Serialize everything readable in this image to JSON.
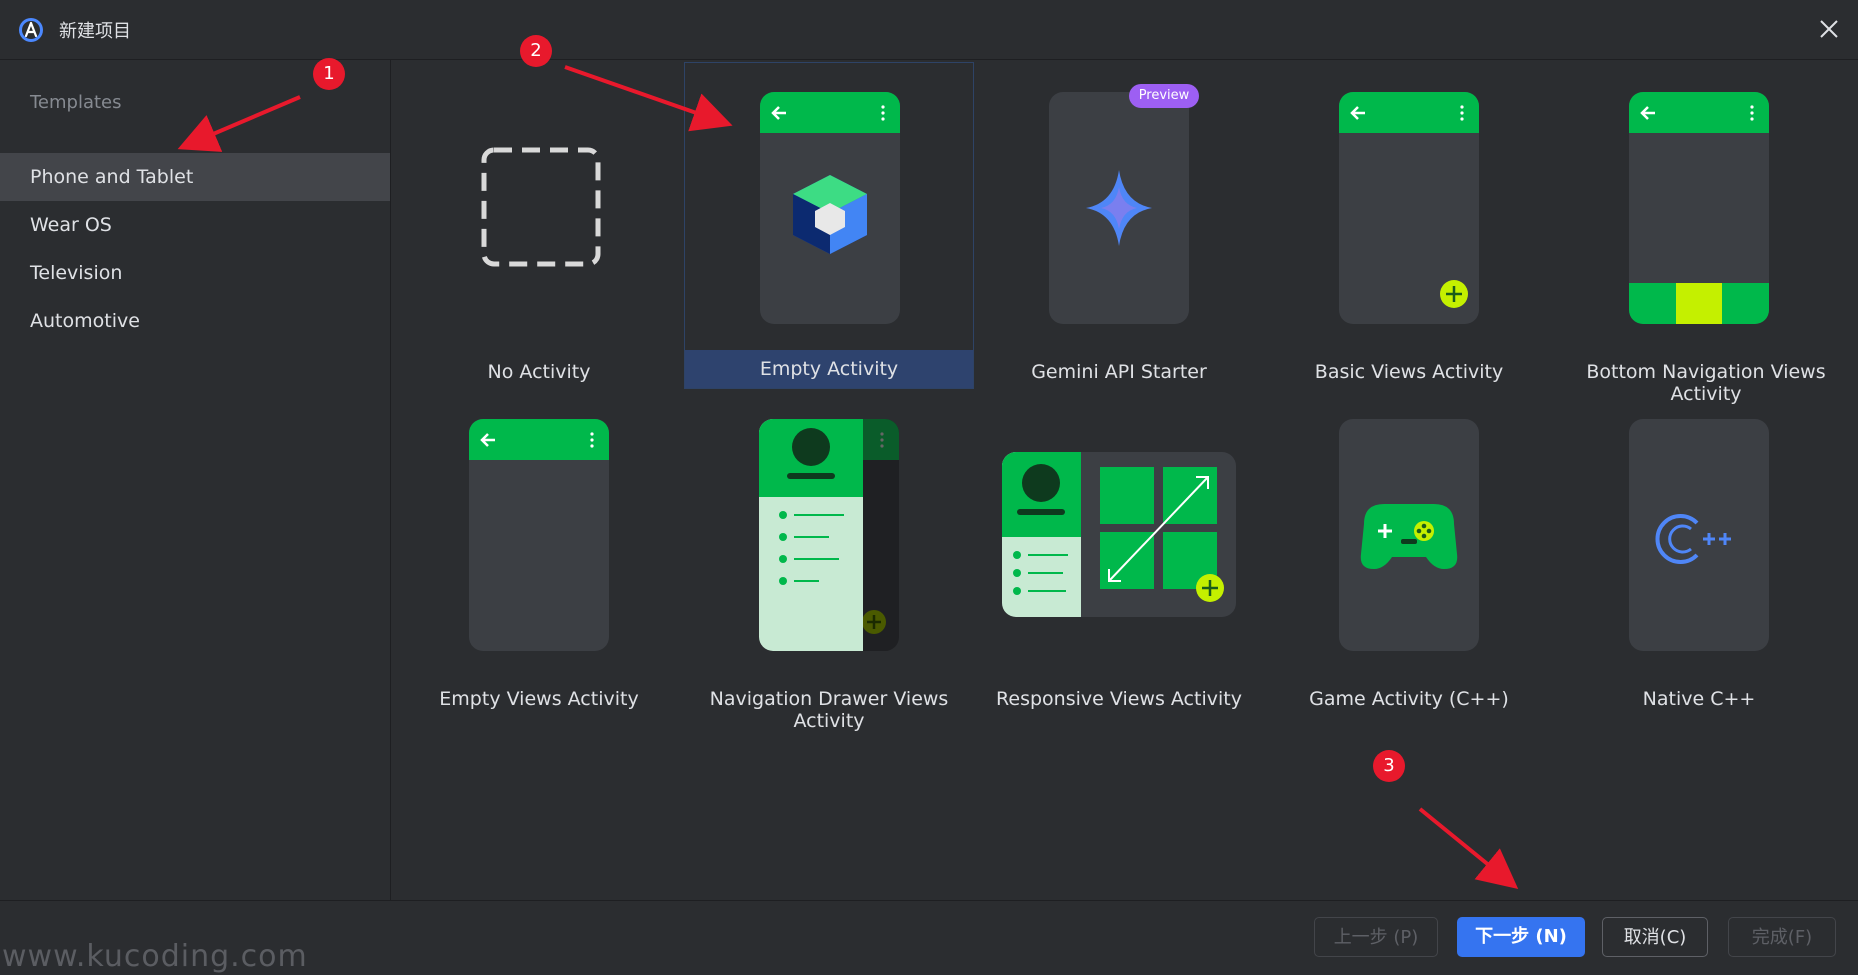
{
  "window": {
    "title": "新建项目"
  },
  "sidebar": {
    "header": "Templates",
    "items": [
      {
        "label": "Phone and Tablet",
        "selected": true
      },
      {
        "label": "Wear OS",
        "selected": false
      },
      {
        "label": "Television",
        "selected": false
      },
      {
        "label": "Automotive",
        "selected": false
      }
    ]
  },
  "templates": [
    {
      "label": "No Activity"
    },
    {
      "label": "Empty Activity",
      "selected": true
    },
    {
      "label": "Gemini API Starter",
      "badge": "Preview"
    },
    {
      "label": "Basic Views Activity"
    },
    {
      "label": "Bottom Navigation Views Activity"
    },
    {
      "label": "Empty Views Activity"
    },
    {
      "label": "Navigation Drawer Views Activity"
    },
    {
      "label": "Responsive Views Activity"
    },
    {
      "label": "Game Activity (C++)"
    },
    {
      "label": "Native C++"
    }
  ],
  "footer": {
    "prev": "上一步 (P)",
    "next": "下一步 (N)",
    "cancel": "取消(C)",
    "finish": "完成(F)",
    "watermark": "www.kucoding.com"
  },
  "annotations": [
    "1",
    "2",
    "3"
  ],
  "colors": {
    "accent": "#3574f0",
    "android_green": "#00b84b",
    "lime": "#c4f000",
    "annotation_red": "#e8192c",
    "selection": "#2e436e"
  }
}
